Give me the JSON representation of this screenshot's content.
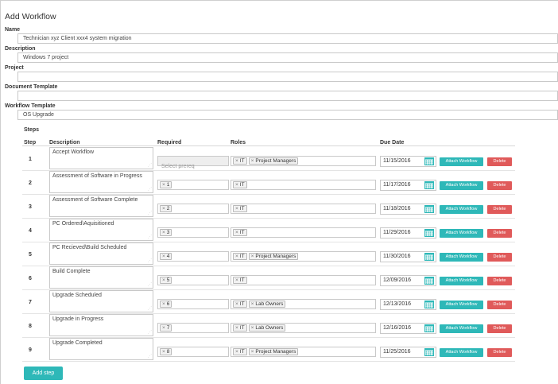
{
  "page": {
    "title": "Add Workflow"
  },
  "form": {
    "name": {
      "label": "Name",
      "value": "Technician xyz Client xxx4 system migration"
    },
    "description": {
      "label": "Description",
      "value": "Windows 7 project"
    },
    "project": {
      "label": "Project",
      "value": ""
    },
    "document_template": {
      "label": "Document Template",
      "value": ""
    },
    "workflow_template": {
      "label": "Workflow Template",
      "value": "OS Upgrade"
    }
  },
  "steps": {
    "label": "Steps",
    "columns": {
      "step": "Step",
      "description": "Description",
      "required": "Required",
      "roles": "Roles",
      "due_date": "Due Date"
    },
    "required_placeholder": "Select prereq",
    "attach_label": "Attach Workflow",
    "delete_label": "Delete",
    "add_label": "Add step",
    "rows": [
      {
        "step": "1",
        "description": "Accept Workflow",
        "required": [],
        "roles": [
          "IT",
          "Project Managers"
        ],
        "due": "11/15/2016"
      },
      {
        "step": "2",
        "description": "Assessment of Software in Progress",
        "required": [
          "1"
        ],
        "roles": [
          "IT"
        ],
        "due": "11/17/2016"
      },
      {
        "step": "3",
        "description": "Assessment of Software Complete",
        "required": [
          "2"
        ],
        "roles": [
          "IT"
        ],
        "due": "11/18/2016"
      },
      {
        "step": "4",
        "description": "PC Ordered\\Aquisitioned",
        "required": [
          "3"
        ],
        "roles": [
          "IT"
        ],
        "due": "11/29/2016"
      },
      {
        "step": "5",
        "description": "PC Recieved\\Build Scheduled",
        "required": [
          "4"
        ],
        "roles": [
          "IT",
          "Project Managers"
        ],
        "due": "11/30/2016"
      },
      {
        "step": "6",
        "description": "Build Complete",
        "required": [
          "5"
        ],
        "roles": [
          "IT"
        ],
        "due": "12/09/2016"
      },
      {
        "step": "7",
        "description": "Upgrade Scheduled",
        "required": [
          "6"
        ],
        "roles": [
          "IT",
          "Lab Owners"
        ],
        "due": "12/13/2016"
      },
      {
        "step": "8",
        "description": "Upgrade in Progress",
        "required": [
          "7"
        ],
        "roles": [
          "IT",
          "Lab Owners"
        ],
        "due": "12/16/2016"
      },
      {
        "step": "9",
        "description": "Upgrade Completed",
        "required": [
          "8"
        ],
        "roles": [
          "IT",
          "Project Managers"
        ],
        "due": "11/25/2016"
      }
    ]
  },
  "icons": {
    "calendar": "calendar-icon",
    "tag_remove": "×",
    "resize": "resize-grip-icon"
  },
  "colors": {
    "accent": "#2eb8b8",
    "danger": "#e05a5a",
    "calendar": "#2eb8b8"
  }
}
